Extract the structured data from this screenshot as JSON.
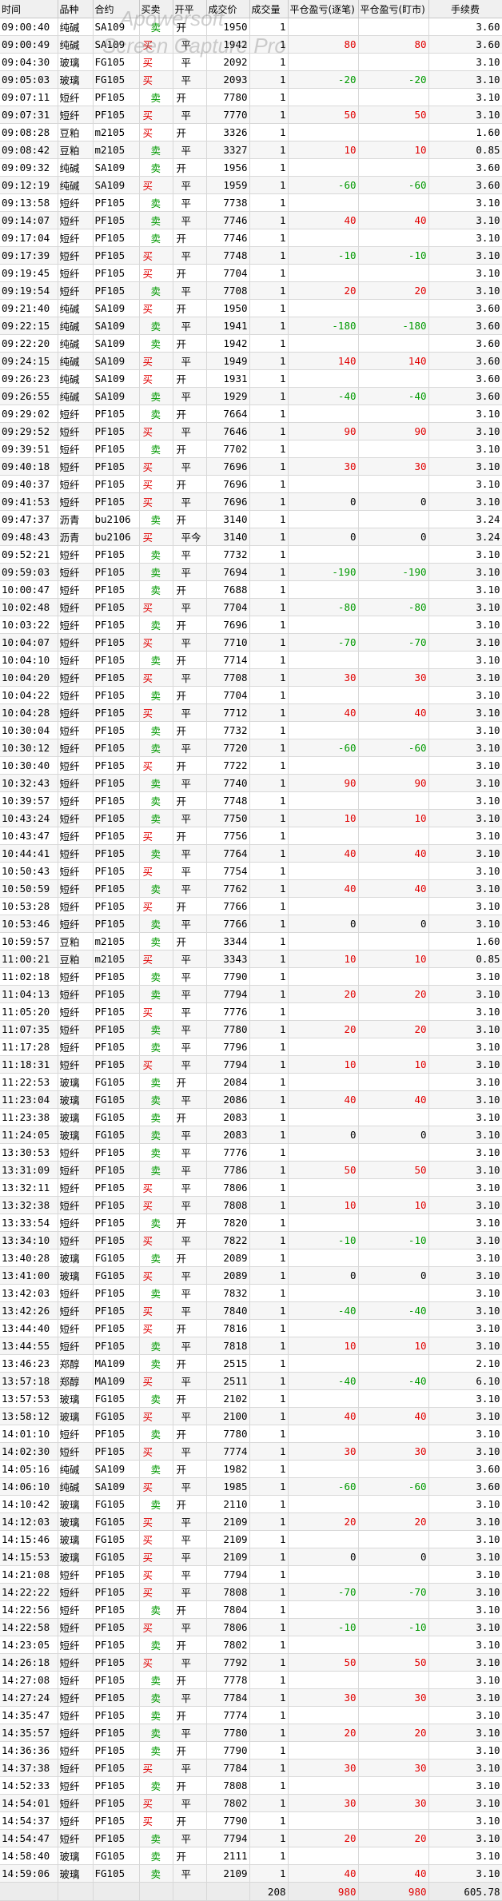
{
  "watermark": {
    "line1": "Apowersoft",
    "line2": "Screen Capture Pro"
  },
  "colors": {
    "buy": "#e00000",
    "sell": "#009900",
    "profit": "#e00000",
    "loss": "#009900"
  },
  "headers": [
    "时间",
    "品种",
    "合约",
    "买卖",
    "开平",
    "成交价",
    "成交量",
    "平仓盈亏(逐笔)",
    "平仓盈亏(盯市)",
    "手续费"
  ],
  "rows": [
    [
      "09:00:40",
      "纯碱",
      "SA109",
      "卖",
      "开",
      "1950",
      "1",
      "",
      "",
      "3.60"
    ],
    [
      "09:00:49",
      "纯碱",
      "SA109",
      "买",
      "平",
      "1942",
      "1",
      "80",
      "80",
      "3.60"
    ],
    [
      "09:04:30",
      "玻璃",
      "FG105",
      "买",
      "平",
      "2092",
      "1",
      "",
      "",
      "3.10"
    ],
    [
      "09:05:03",
      "玻璃",
      "FG105",
      "买",
      "平",
      "2093",
      "1",
      "-20",
      "-20",
      "3.10"
    ],
    [
      "09:07:11",
      "短纤",
      "PF105",
      "卖",
      "开",
      "7780",
      "1",
      "",
      "",
      "3.10"
    ],
    [
      "09:07:31",
      "短纤",
      "PF105",
      "买",
      "平",
      "7770",
      "1",
      "50",
      "50",
      "3.10"
    ],
    [
      "09:08:28",
      "豆粕",
      "m2105",
      "买",
      "开",
      "3326",
      "1",
      "",
      "",
      "1.60"
    ],
    [
      "09:08:42",
      "豆粕",
      "m2105",
      "卖",
      "平",
      "3327",
      "1",
      "10",
      "10",
      "0.85"
    ],
    [
      "09:09:32",
      "纯碱",
      "SA109",
      "卖",
      "开",
      "1956",
      "1",
      "",
      "",
      "3.60"
    ],
    [
      "09:12:19",
      "纯碱",
      "SA109",
      "买",
      "平",
      "1959",
      "1",
      "-60",
      "-60",
      "3.60"
    ],
    [
      "09:13:58",
      "短纤",
      "PF105",
      "卖",
      "平",
      "7738",
      "1",
      "",
      "",
      "3.10"
    ],
    [
      "09:14:07",
      "短纤",
      "PF105",
      "卖",
      "平",
      "7746",
      "1",
      "40",
      "40",
      "3.10"
    ],
    [
      "09:17:04",
      "短纤",
      "PF105",
      "卖",
      "开",
      "7746",
      "1",
      "",
      "",
      "3.10"
    ],
    [
      "09:17:39",
      "短纤",
      "PF105",
      "买",
      "平",
      "7748",
      "1",
      "-10",
      "-10",
      "3.10"
    ],
    [
      "09:19:45",
      "短纤",
      "PF105",
      "买",
      "开",
      "7704",
      "1",
      "",
      "",
      "3.10"
    ],
    [
      "09:19:54",
      "短纤",
      "PF105",
      "卖",
      "平",
      "7708",
      "1",
      "20",
      "20",
      "3.10"
    ],
    [
      "09:21:40",
      "纯碱",
      "SA109",
      "买",
      "开",
      "1950",
      "1",
      "",
      "",
      "3.60"
    ],
    [
      "09:22:15",
      "纯碱",
      "SA109",
      "卖",
      "平",
      "1941",
      "1",
      "-180",
      "-180",
      "3.60"
    ],
    [
      "09:22:20",
      "纯碱",
      "SA109",
      "卖",
      "开",
      "1942",
      "1",
      "",
      "",
      "3.60"
    ],
    [
      "09:24:15",
      "纯碱",
      "SA109",
      "买",
      "平",
      "1949",
      "1",
      "140",
      "140",
      "3.60"
    ],
    [
      "09:26:23",
      "纯碱",
      "SA109",
      "买",
      "开",
      "1931",
      "1",
      "",
      "",
      "3.60"
    ],
    [
      "09:26:55",
      "纯碱",
      "SA109",
      "卖",
      "平",
      "1929",
      "1",
      "-40",
      "-40",
      "3.60"
    ],
    [
      "09:29:02",
      "短纤",
      "PF105",
      "卖",
      "开",
      "7664",
      "1",
      "",
      "",
      "3.10"
    ],
    [
      "09:29:52",
      "短纤",
      "PF105",
      "买",
      "平",
      "7646",
      "1",
      "90",
      "90",
      "3.10"
    ],
    [
      "09:39:51",
      "短纤",
      "PF105",
      "卖",
      "开",
      "7702",
      "1",
      "",
      "",
      "3.10"
    ],
    [
      "09:40:18",
      "短纤",
      "PF105",
      "买",
      "平",
      "7696",
      "1",
      "30",
      "30",
      "3.10"
    ],
    [
      "09:40:37",
      "短纤",
      "PF105",
      "买",
      "开",
      "7696",
      "1",
      "",
      "",
      "3.10"
    ],
    [
      "09:41:53",
      "短纤",
      "PF105",
      "买",
      "平",
      "7696",
      "1",
      "0",
      "0",
      "3.10"
    ],
    [
      "09:47:37",
      "沥青",
      "bu2106",
      "卖",
      "开",
      "3140",
      "1",
      "",
      "",
      "3.24"
    ],
    [
      "09:48:43",
      "沥青",
      "bu2106",
      "买",
      "平今",
      "3140",
      "1",
      "0",
      "0",
      "3.24"
    ],
    [
      "09:52:21",
      "短纤",
      "PF105",
      "卖",
      "平",
      "7732",
      "1",
      "",
      "",
      "3.10"
    ],
    [
      "09:59:03",
      "短纤",
      "PF105",
      "卖",
      "平",
      "7694",
      "1",
      "-190",
      "-190",
      "3.10"
    ],
    [
      "10:00:47",
      "短纤",
      "PF105",
      "卖",
      "开",
      "7688",
      "1",
      "",
      "",
      "3.10"
    ],
    [
      "10:02:48",
      "短纤",
      "PF105",
      "买",
      "平",
      "7704",
      "1",
      "-80",
      "-80",
      "3.10"
    ],
    [
      "10:03:22",
      "短纤",
      "PF105",
      "卖",
      "开",
      "7696",
      "1",
      "",
      "",
      "3.10"
    ],
    [
      "10:04:07",
      "短纤",
      "PF105",
      "买",
      "平",
      "7710",
      "1",
      "-70",
      "-70",
      "3.10"
    ],
    [
      "10:04:10",
      "短纤",
      "PF105",
      "卖",
      "开",
      "7714",
      "1",
      "",
      "",
      "3.10"
    ],
    [
      "10:04:20",
      "短纤",
      "PF105",
      "买",
      "平",
      "7708",
      "1",
      "30",
      "30",
      "3.10"
    ],
    [
      "10:04:22",
      "短纤",
      "PF105",
      "卖",
      "开",
      "7704",
      "1",
      "",
      "",
      "3.10"
    ],
    [
      "10:04:28",
      "短纤",
      "PF105",
      "买",
      "平",
      "7712",
      "1",
      "40",
      "40",
      "3.10"
    ],
    [
      "10:30:04",
      "短纤",
      "PF105",
      "卖",
      "开",
      "7732",
      "1",
      "",
      "",
      "3.10"
    ],
    [
      "10:30:12",
      "短纤",
      "PF105",
      "卖",
      "平",
      "7720",
      "1",
      "-60",
      "-60",
      "3.10"
    ],
    [
      "10:30:40",
      "短纤",
      "PF105",
      "买",
      "开",
      "7722",
      "1",
      "",
      "",
      "3.10"
    ],
    [
      "10:32:43",
      "短纤",
      "PF105",
      "卖",
      "平",
      "7740",
      "1",
      "90",
      "90",
      "3.10"
    ],
    [
      "10:39:57",
      "短纤",
      "PF105",
      "卖",
      "开",
      "7748",
      "1",
      "",
      "",
      "3.10"
    ],
    [
      "10:43:24",
      "短纤",
      "PF105",
      "卖",
      "平",
      "7750",
      "1",
      "10",
      "10",
      "3.10"
    ],
    [
      "10:43:47",
      "短纤",
      "PF105",
      "买",
      "开",
      "7756",
      "1",
      "",
      "",
      "3.10"
    ],
    [
      "10:44:41",
      "短纤",
      "PF105",
      "卖",
      "平",
      "7764",
      "1",
      "40",
      "40",
      "3.10"
    ],
    [
      "10:50:43",
      "短纤",
      "PF105",
      "买",
      "平",
      "7754",
      "1",
      "",
      "",
      "3.10"
    ],
    [
      "10:50:59",
      "短纤",
      "PF105",
      "卖",
      "平",
      "7762",
      "1",
      "40",
      "40",
      "3.10"
    ],
    [
      "10:53:28",
      "短纤",
      "PF105",
      "买",
      "开",
      "7766",
      "1",
      "",
      "",
      "3.10"
    ],
    [
      "10:53:46",
      "短纤",
      "PF105",
      "卖",
      "平",
      "7766",
      "1",
      "0",
      "0",
      "3.10"
    ],
    [
      "10:59:57",
      "豆粕",
      "m2105",
      "卖",
      "开",
      "3344",
      "1",
      "",
      "",
      "1.60"
    ],
    [
      "11:00:21",
      "豆粕",
      "m2105",
      "买",
      "平",
      "3343",
      "1",
      "10",
      "10",
      "0.85"
    ],
    [
      "11:02:18",
      "短纤",
      "PF105",
      "卖",
      "平",
      "7790",
      "1",
      "",
      "",
      "3.10"
    ],
    [
      "11:04:13",
      "短纤",
      "PF105",
      "卖",
      "平",
      "7794",
      "1",
      "20",
      "20",
      "3.10"
    ],
    [
      "11:05:20",
      "短纤",
      "PF105",
      "买",
      "平",
      "7776",
      "1",
      "",
      "",
      "3.10"
    ],
    [
      "11:07:35",
      "短纤",
      "PF105",
      "卖",
      "平",
      "7780",
      "1",
      "20",
      "20",
      "3.10"
    ],
    [
      "11:17:28",
      "短纤",
      "PF105",
      "卖",
      "平",
      "7796",
      "1",
      "",
      "",
      "3.10"
    ],
    [
      "11:18:31",
      "短纤",
      "PF105",
      "买",
      "平",
      "7794",
      "1",
      "10",
      "10",
      "3.10"
    ],
    [
      "11:22:53",
      "玻璃",
      "FG105",
      "卖",
      "开",
      "2084",
      "1",
      "",
      "",
      "3.10"
    ],
    [
      "11:23:04",
      "玻璃",
      "FG105",
      "卖",
      "平",
      "2086",
      "1",
      "40",
      "40",
      "3.10"
    ],
    [
      "11:23:38",
      "玻璃",
      "FG105",
      "卖",
      "开",
      "2083",
      "1",
      "",
      "",
      "3.10"
    ],
    [
      "11:24:05",
      "玻璃",
      "FG105",
      "卖",
      "平",
      "2083",
      "1",
      "0",
      "0",
      "3.10"
    ],
    [
      "13:30:53",
      "短纤",
      "PF105",
      "卖",
      "平",
      "7776",
      "1",
      "",
      "",
      "3.10"
    ],
    [
      "13:31:09",
      "短纤",
      "PF105",
      "卖",
      "平",
      "7786",
      "1",
      "50",
      "50",
      "3.10"
    ],
    [
      "13:32:11",
      "短纤",
      "PF105",
      "买",
      "平",
      "7806",
      "1",
      "",
      "",
      "3.10"
    ],
    [
      "13:32:38",
      "短纤",
      "PF105",
      "买",
      "平",
      "7808",
      "1",
      "10",
      "10",
      "3.10"
    ],
    [
      "13:33:54",
      "短纤",
      "PF105",
      "卖",
      "开",
      "7820",
      "1",
      "",
      "",
      "3.10"
    ],
    [
      "13:34:10",
      "短纤",
      "PF105",
      "买",
      "平",
      "7822",
      "1",
      "-10",
      "-10",
      "3.10"
    ],
    [
      "13:40:28",
      "玻璃",
      "FG105",
      "卖",
      "开",
      "2089",
      "1",
      "",
      "",
      "3.10"
    ],
    [
      "13:41:00",
      "玻璃",
      "FG105",
      "买",
      "平",
      "2089",
      "1",
      "0",
      "0",
      "3.10"
    ],
    [
      "13:42:03",
      "短纤",
      "PF105",
      "卖",
      "平",
      "7832",
      "1",
      "",
      "",
      "3.10"
    ],
    [
      "13:42:26",
      "短纤",
      "PF105",
      "买",
      "平",
      "7840",
      "1",
      "-40",
      "-40",
      "3.10"
    ],
    [
      "13:44:40",
      "短纤",
      "PF105",
      "买",
      "开",
      "7816",
      "1",
      "",
      "",
      "3.10"
    ],
    [
      "13:44:55",
      "短纤",
      "PF105",
      "卖",
      "平",
      "7818",
      "1",
      "10",
      "10",
      "3.10"
    ],
    [
      "13:46:23",
      "郑醇",
      "MA109",
      "卖",
      "开",
      "2515",
      "1",
      "",
      "",
      "2.10"
    ],
    [
      "13:57:18",
      "郑醇",
      "MA109",
      "买",
      "平",
      "2511",
      "1",
      "-40",
      "-40",
      "6.10"
    ],
    [
      "13:57:53",
      "玻璃",
      "FG105",
      "卖",
      "开",
      "2102",
      "1",
      "",
      "",
      "3.10"
    ],
    [
      "13:58:12",
      "玻璃",
      "FG105",
      "买",
      "平",
      "2100",
      "1",
      "40",
      "40",
      "3.10"
    ],
    [
      "14:01:10",
      "短纤",
      "PF105",
      "卖",
      "开",
      "7780",
      "1",
      "",
      "",
      "3.10"
    ],
    [
      "14:02:30",
      "短纤",
      "PF105",
      "买",
      "平",
      "7774",
      "1",
      "30",
      "30",
      "3.10"
    ],
    [
      "14:05:16",
      "纯碱",
      "SA109",
      "卖",
      "开",
      "1982",
      "1",
      "",
      "",
      "3.60"
    ],
    [
      "14:06:10",
      "纯碱",
      "SA109",
      "买",
      "平",
      "1985",
      "1",
      "-60",
      "-60",
      "3.60"
    ],
    [
      "14:10:42",
      "玻璃",
      "FG105",
      "卖",
      "开",
      "2110",
      "1",
      "",
      "",
      "3.10"
    ],
    [
      "14:12:03",
      "玻璃",
      "FG105",
      "买",
      "平",
      "2109",
      "1",
      "20",
      "20",
      "3.10"
    ],
    [
      "14:15:46",
      "玻璃",
      "FG105",
      "买",
      "平",
      "2109",
      "1",
      "",
      "",
      "3.10"
    ],
    [
      "14:15:53",
      "玻璃",
      "FG105",
      "买",
      "平",
      "2109",
      "1",
      "0",
      "0",
      "3.10"
    ],
    [
      "14:21:08",
      "短纤",
      "PF105",
      "买",
      "平",
      "7794",
      "1",
      "",
      "",
      "3.10"
    ],
    [
      "14:22:22",
      "短纤",
      "PF105",
      "买",
      "平",
      "7808",
      "1",
      "-70",
      "-70",
      "3.10"
    ],
    [
      "14:22:56",
      "短纤",
      "PF105",
      "卖",
      "开",
      "7804",
      "1",
      "",
      "",
      "3.10"
    ],
    [
      "14:22:58",
      "短纤",
      "PF105",
      "买",
      "平",
      "7806",
      "1",
      "-10",
      "-10",
      "3.10"
    ],
    [
      "14:23:05",
      "短纤",
      "PF105",
      "卖",
      "开",
      "7802",
      "1",
      "",
      "",
      "3.10"
    ],
    [
      "14:26:18",
      "短纤",
      "PF105",
      "买",
      "平",
      "7792",
      "1",
      "50",
      "50",
      "3.10"
    ],
    [
      "14:27:08",
      "短纤",
      "PF105",
      "卖",
      "开",
      "7778",
      "1",
      "",
      "",
      "3.10"
    ],
    [
      "14:27:24",
      "短纤",
      "PF105",
      "卖",
      "平",
      "7784",
      "1",
      "30",
      "30",
      "3.10"
    ],
    [
      "14:35:47",
      "短纤",
      "PF105",
      "卖",
      "开",
      "7774",
      "1",
      "",
      "",
      "3.10"
    ],
    [
      "14:35:57",
      "短纤",
      "PF105",
      "卖",
      "平",
      "7780",
      "1",
      "20",
      "20",
      "3.10"
    ],
    [
      "14:36:36",
      "短纤",
      "PF105",
      "卖",
      "开",
      "7790",
      "1",
      "",
      "",
      "3.10"
    ],
    [
      "14:37:38",
      "短纤",
      "PF105",
      "买",
      "平",
      "7784",
      "1",
      "30",
      "30",
      "3.10"
    ],
    [
      "14:52:33",
      "短纤",
      "PF105",
      "卖",
      "开",
      "7808",
      "1",
      "",
      "",
      "3.10"
    ],
    [
      "14:54:01",
      "短纤",
      "PF105",
      "买",
      "平",
      "7802",
      "1",
      "30",
      "30",
      "3.10"
    ],
    [
      "14:54:37",
      "短纤",
      "PF105",
      "买",
      "开",
      "7790",
      "1",
      "",
      "",
      "3.10"
    ],
    [
      "14:54:47",
      "短纤",
      "PF105",
      "卖",
      "平",
      "7794",
      "1",
      "20",
      "20",
      "3.10"
    ],
    [
      "14:58:40",
      "玻璃",
      "FG105",
      "卖",
      "开",
      "2111",
      "1",
      "",
      "",
      "3.10"
    ],
    [
      "14:59:06",
      "玻璃",
      "FG105",
      "卖",
      "平",
      "2109",
      "1",
      "40",
      "40",
      "3.10"
    ]
  ],
  "totals": {
    "volume": "208",
    "pnl_trade": "980",
    "pnl_mark": "980",
    "fee": "605.78"
  }
}
